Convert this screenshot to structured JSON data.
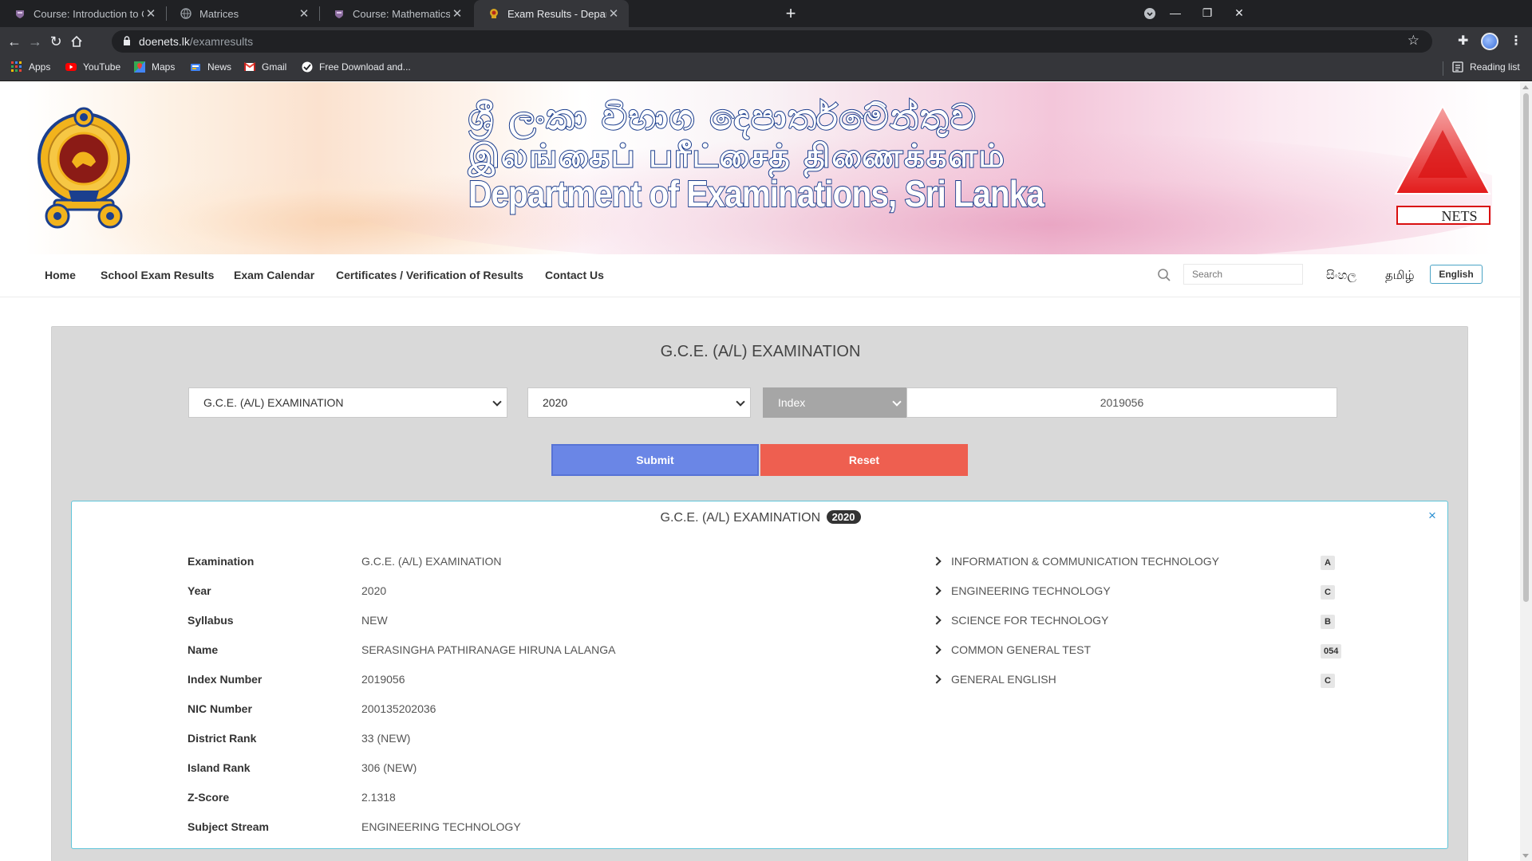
{
  "browser": {
    "tabs": [
      {
        "title": "Course: Introduction to Compute",
        "active": false
      },
      {
        "title": "Matrices",
        "active": false
      },
      {
        "title": "Course: Mathematics for Comput",
        "active": false
      },
      {
        "title": "Exam Results - Department of Ex",
        "active": true
      }
    ],
    "url_domain": "doenets.lk",
    "url_path": "/examresults",
    "bookmarks": [
      "Apps",
      "YouTube",
      "Maps",
      "News",
      "Gmail",
      "Free Download and..."
    ],
    "reading_list": "Reading list"
  },
  "banner": {
    "sinhala": "ශ්‍රී ලංකා විභාග දෙපාර්තමේන්තුව",
    "tamil": "இலங்கைப் பரீட்சைத் திணைக்களம்",
    "english": "Department of Examinations, Sri Lanka",
    "nets_label": "NETS"
  },
  "nav": {
    "items": [
      "Home",
      "School Exam Results",
      "Exam Calendar",
      "Certificates / Verification of Results",
      "Contact Us"
    ],
    "search_placeholder": "Search",
    "lang_si": "සිංහල",
    "lang_ta": "தமிழ்",
    "lang_en": "English"
  },
  "form": {
    "title": "G.C.E. (A/L) EXAMINATION",
    "exam_select": "G.C.E. (A/L) EXAMINATION",
    "year_select": "2020",
    "type_select": "Index",
    "index_value": "2019056",
    "submit_label": "Submit",
    "reset_label": "Reset"
  },
  "result": {
    "title": "G.C.E. (A/L) EXAMINATION",
    "year_badge": "2020",
    "close": "×",
    "details": [
      {
        "label": "Examination",
        "value": "G.C.E. (A/L) EXAMINATION"
      },
      {
        "label": "Year",
        "value": "2020"
      },
      {
        "label": "Syllabus",
        "value": "NEW"
      },
      {
        "label": "Name",
        "value": "SERASINGHA PATHIRANAGE HIRUNA LALANGA"
      },
      {
        "label": "Index Number",
        "value": "2019056"
      },
      {
        "label": "NIC Number",
        "value": "200135202036"
      },
      {
        "label": "District Rank",
        "value": "33 (NEW)"
      },
      {
        "label": "Island Rank",
        "value": "306 (NEW)"
      },
      {
        "label": "Z-Score",
        "value": "2.1318"
      },
      {
        "label": "Subject Stream",
        "value": "ENGINEERING TECHNOLOGY"
      }
    ],
    "subjects": [
      {
        "name": "INFORMATION & COMMUNICATION TECHNOLOGY",
        "grade": "A"
      },
      {
        "name": "ENGINEERING TECHNOLOGY",
        "grade": "C"
      },
      {
        "name": "SCIENCE FOR TECHNOLOGY",
        "grade": "B"
      },
      {
        "name": "COMMON GENERAL TEST",
        "grade": "054"
      },
      {
        "name": "GENERAL ENGLISH",
        "grade": "C"
      }
    ]
  },
  "colors": {
    "submit": "#6a86e6",
    "reset": "#ee5f50",
    "result_border": "#5fc5d9",
    "panel_bg": "#d9d9d9"
  }
}
